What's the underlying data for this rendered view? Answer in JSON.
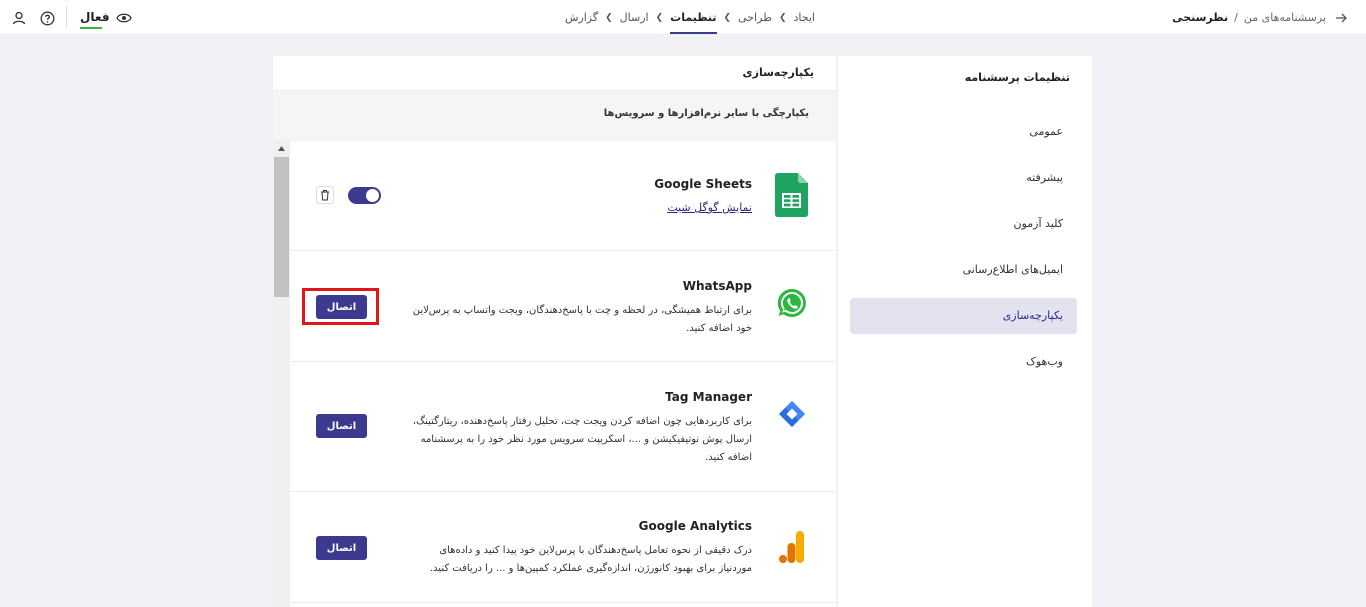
{
  "header": {
    "status_label": "فعال",
    "steps": [
      "ایجاد",
      "طراحی",
      "تنظیمات",
      "ارسال",
      "گزارش"
    ],
    "active_step": "تنظیمات",
    "breadcrumb": {
      "root": "پرسشنامه‌های من",
      "separator": "/",
      "current": "نظرسنجی"
    }
  },
  "sidebar": {
    "title": "تنظیمات پرسشنامه",
    "items": [
      {
        "label": "عمومی",
        "active": false
      },
      {
        "label": "پیشرفته",
        "active": false
      },
      {
        "label": "کلید آزمون",
        "active": false
      },
      {
        "label": "ایمیل‌های اطلاع‌رسانی",
        "active": false
      },
      {
        "label": "یکپارچه‌سازی",
        "active": true
      },
      {
        "label": "وب‌هوک",
        "active": false
      }
    ]
  },
  "panel": {
    "title": "یکپارچه‌سازی",
    "subtitle": "یکپارچگی با سایر نرم‌افزارها و سرویس‌ها"
  },
  "integrations": [
    {
      "name": "Google Sheets",
      "link": "نمایش گوگل شیت",
      "enabled": true,
      "icon": "google-sheets-icon"
    },
    {
      "name": "WhatsApp",
      "description": "برای ارتباط همیشگی، در لحظه و چت با پاسخ‌دهندگان، ویجت واتساپ به پرس‌لاین خود اضافه کنید.",
      "button": "اتصال",
      "icon": "whatsapp-icon"
    },
    {
      "name": "Tag Manager",
      "description": "برای کاربردهایی چون اضافه کردن ویجت چت، تحلیل رفتار پاسخ‌دهنده، ریتارگتینگ، ارسال پوش نوتیفیکیشن و ...، اسکریپت سرویس مورد نظر خود را به پرسشنامه اضافه کنید.",
      "button": "اتصال",
      "icon": "tag-manager-icon"
    },
    {
      "name": "Google Analytics",
      "description": "درک دقیقی از نحوه تعامل پاسخ‌دهندگان با پرس‌لاین خود پیدا کنید و داده‌های موردنیاز برای بهبود کانورژن، اندازه‌گیری عملکرد کمپین‌ها و ... را دریافت کنید.",
      "button": "اتصال",
      "icon": "google-analytics-icon"
    }
  ],
  "colors": {
    "primary": "#3c3a8f",
    "active_bg": "#e3e3f0",
    "highlight": "#e0161b",
    "status_green": "#39b54a"
  }
}
